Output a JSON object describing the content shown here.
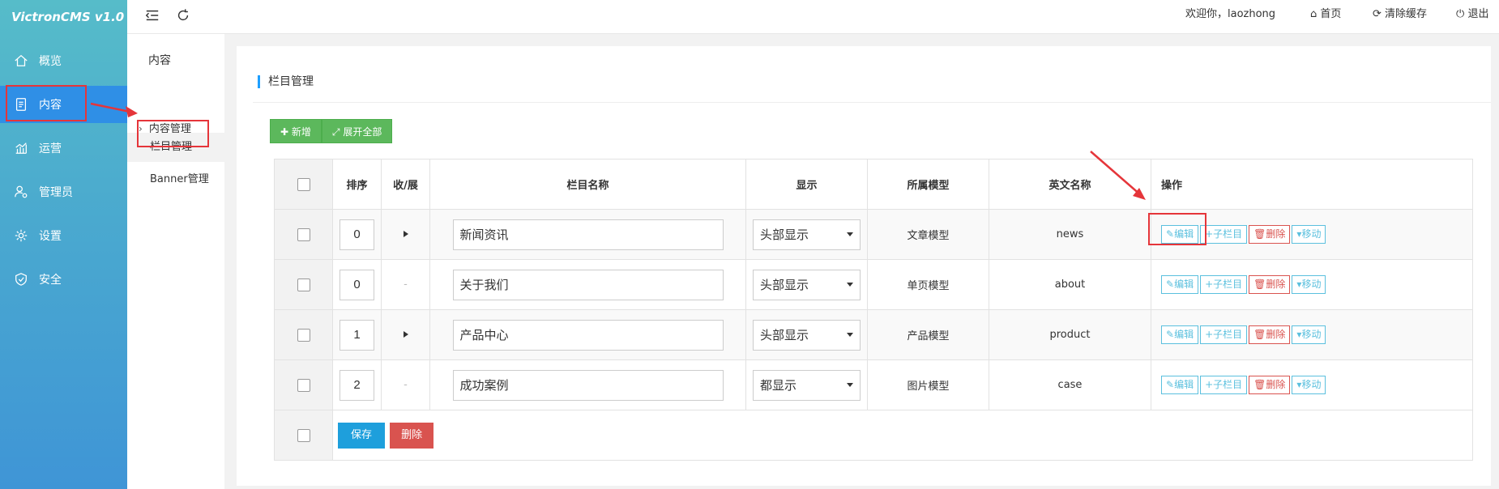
{
  "app": {
    "logo": "VictronCMS v1.0"
  },
  "sidebar": {
    "items": [
      {
        "label": "概览",
        "icon": "home-icon"
      },
      {
        "label": "内容",
        "icon": "document-icon",
        "active": true
      },
      {
        "label": "运营",
        "icon": "chart-icon"
      },
      {
        "label": "管理员",
        "icon": "user-gear-icon"
      },
      {
        "label": "设置",
        "icon": "gear-icon"
      },
      {
        "label": "安全",
        "icon": "shield-icon"
      }
    ]
  },
  "subnav": {
    "title": "内容",
    "group": "内容管理",
    "items": [
      {
        "label": "栏目管理",
        "active": true
      },
      {
        "label": "Banner管理"
      }
    ]
  },
  "topbar": {
    "welcome": "欢迎你，laozhong",
    "home": "首页",
    "clear_cache": "清除缓存",
    "logout": "退出"
  },
  "panel": {
    "title": "栏目管理",
    "add_button": "新增",
    "expand_button": "展开全部"
  },
  "table": {
    "headers": {
      "order": "排序",
      "toggle": "收/展",
      "name": "栏目名称",
      "display": "显示",
      "model": "所属模型",
      "english": "英文名称",
      "actions": "操作"
    },
    "rows": [
      {
        "order": "0",
        "has_children": true,
        "name": "新闻资讯",
        "display": "头部显示",
        "model": "文章模型",
        "english": "news"
      },
      {
        "order": "0",
        "has_children": false,
        "name": "关于我们",
        "display": "头部显示",
        "model": "单页模型",
        "english": "about"
      },
      {
        "order": "1",
        "has_children": true,
        "name": "产品中心",
        "display": "头部显示",
        "model": "产品模型",
        "english": "product"
      },
      {
        "order": "2",
        "has_children": false,
        "name": "成功案例",
        "display": "都显示",
        "model": "图片模型",
        "english": "case"
      }
    ],
    "actions": {
      "edit": "编辑",
      "sub": "子栏目",
      "delete": "删除",
      "move": "移动"
    },
    "dash": "-",
    "footer": {
      "save": "保存",
      "delete": "删除"
    }
  },
  "colors": {
    "annotation": "#e5353a",
    "sidebar_active": "#2f8fe6",
    "green": "#5cb85c",
    "info": "#5bc0de",
    "danger": "#d9534f",
    "primary": "#1e9fdc"
  }
}
